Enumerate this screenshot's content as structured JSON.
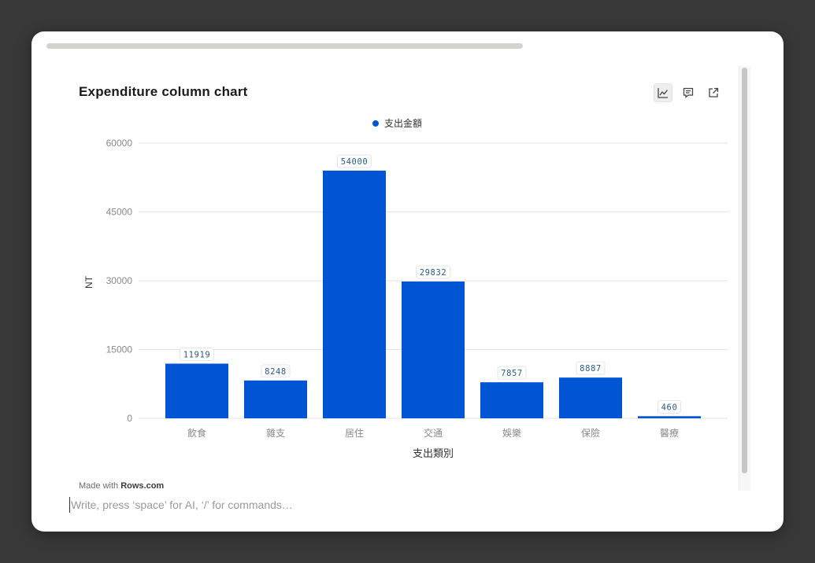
{
  "title": "Expenditure column chart",
  "toolbar": {
    "chart_icon": "line-chart-icon",
    "comment_icon": "comment-icon",
    "open_icon": "external-link-icon"
  },
  "footer": {
    "made_with_prefix": "Made with ",
    "made_with_brand": "Rows.com"
  },
  "editor": {
    "placeholder": "Write, press ‘space’ for AI, ‘/’ for commands…"
  },
  "colors": {
    "bar": "#0055d4",
    "label_text": "#2b5b8a",
    "grid": "#e3e3e3",
    "axis_text": "#8a8a8a"
  },
  "chart_data": {
    "type": "bar",
    "title": "Expenditure column chart",
    "categories": [
      "飲食",
      "雜支",
      "居住",
      "交通",
      "娛樂",
      "保險",
      "醫療"
    ],
    "series": [
      {
        "name": "支出金額",
        "values": [
          11919,
          8248,
          54000,
          29832,
          7857,
          8887,
          460
        ]
      }
    ],
    "xlabel": "支出類別",
    "ylabel": "NT",
    "ylim": [
      0,
      60000
    ],
    "yticks": [
      0,
      15000,
      30000,
      45000,
      60000
    ],
    "grid": true,
    "legend": "top-center",
    "data_labels": true
  }
}
